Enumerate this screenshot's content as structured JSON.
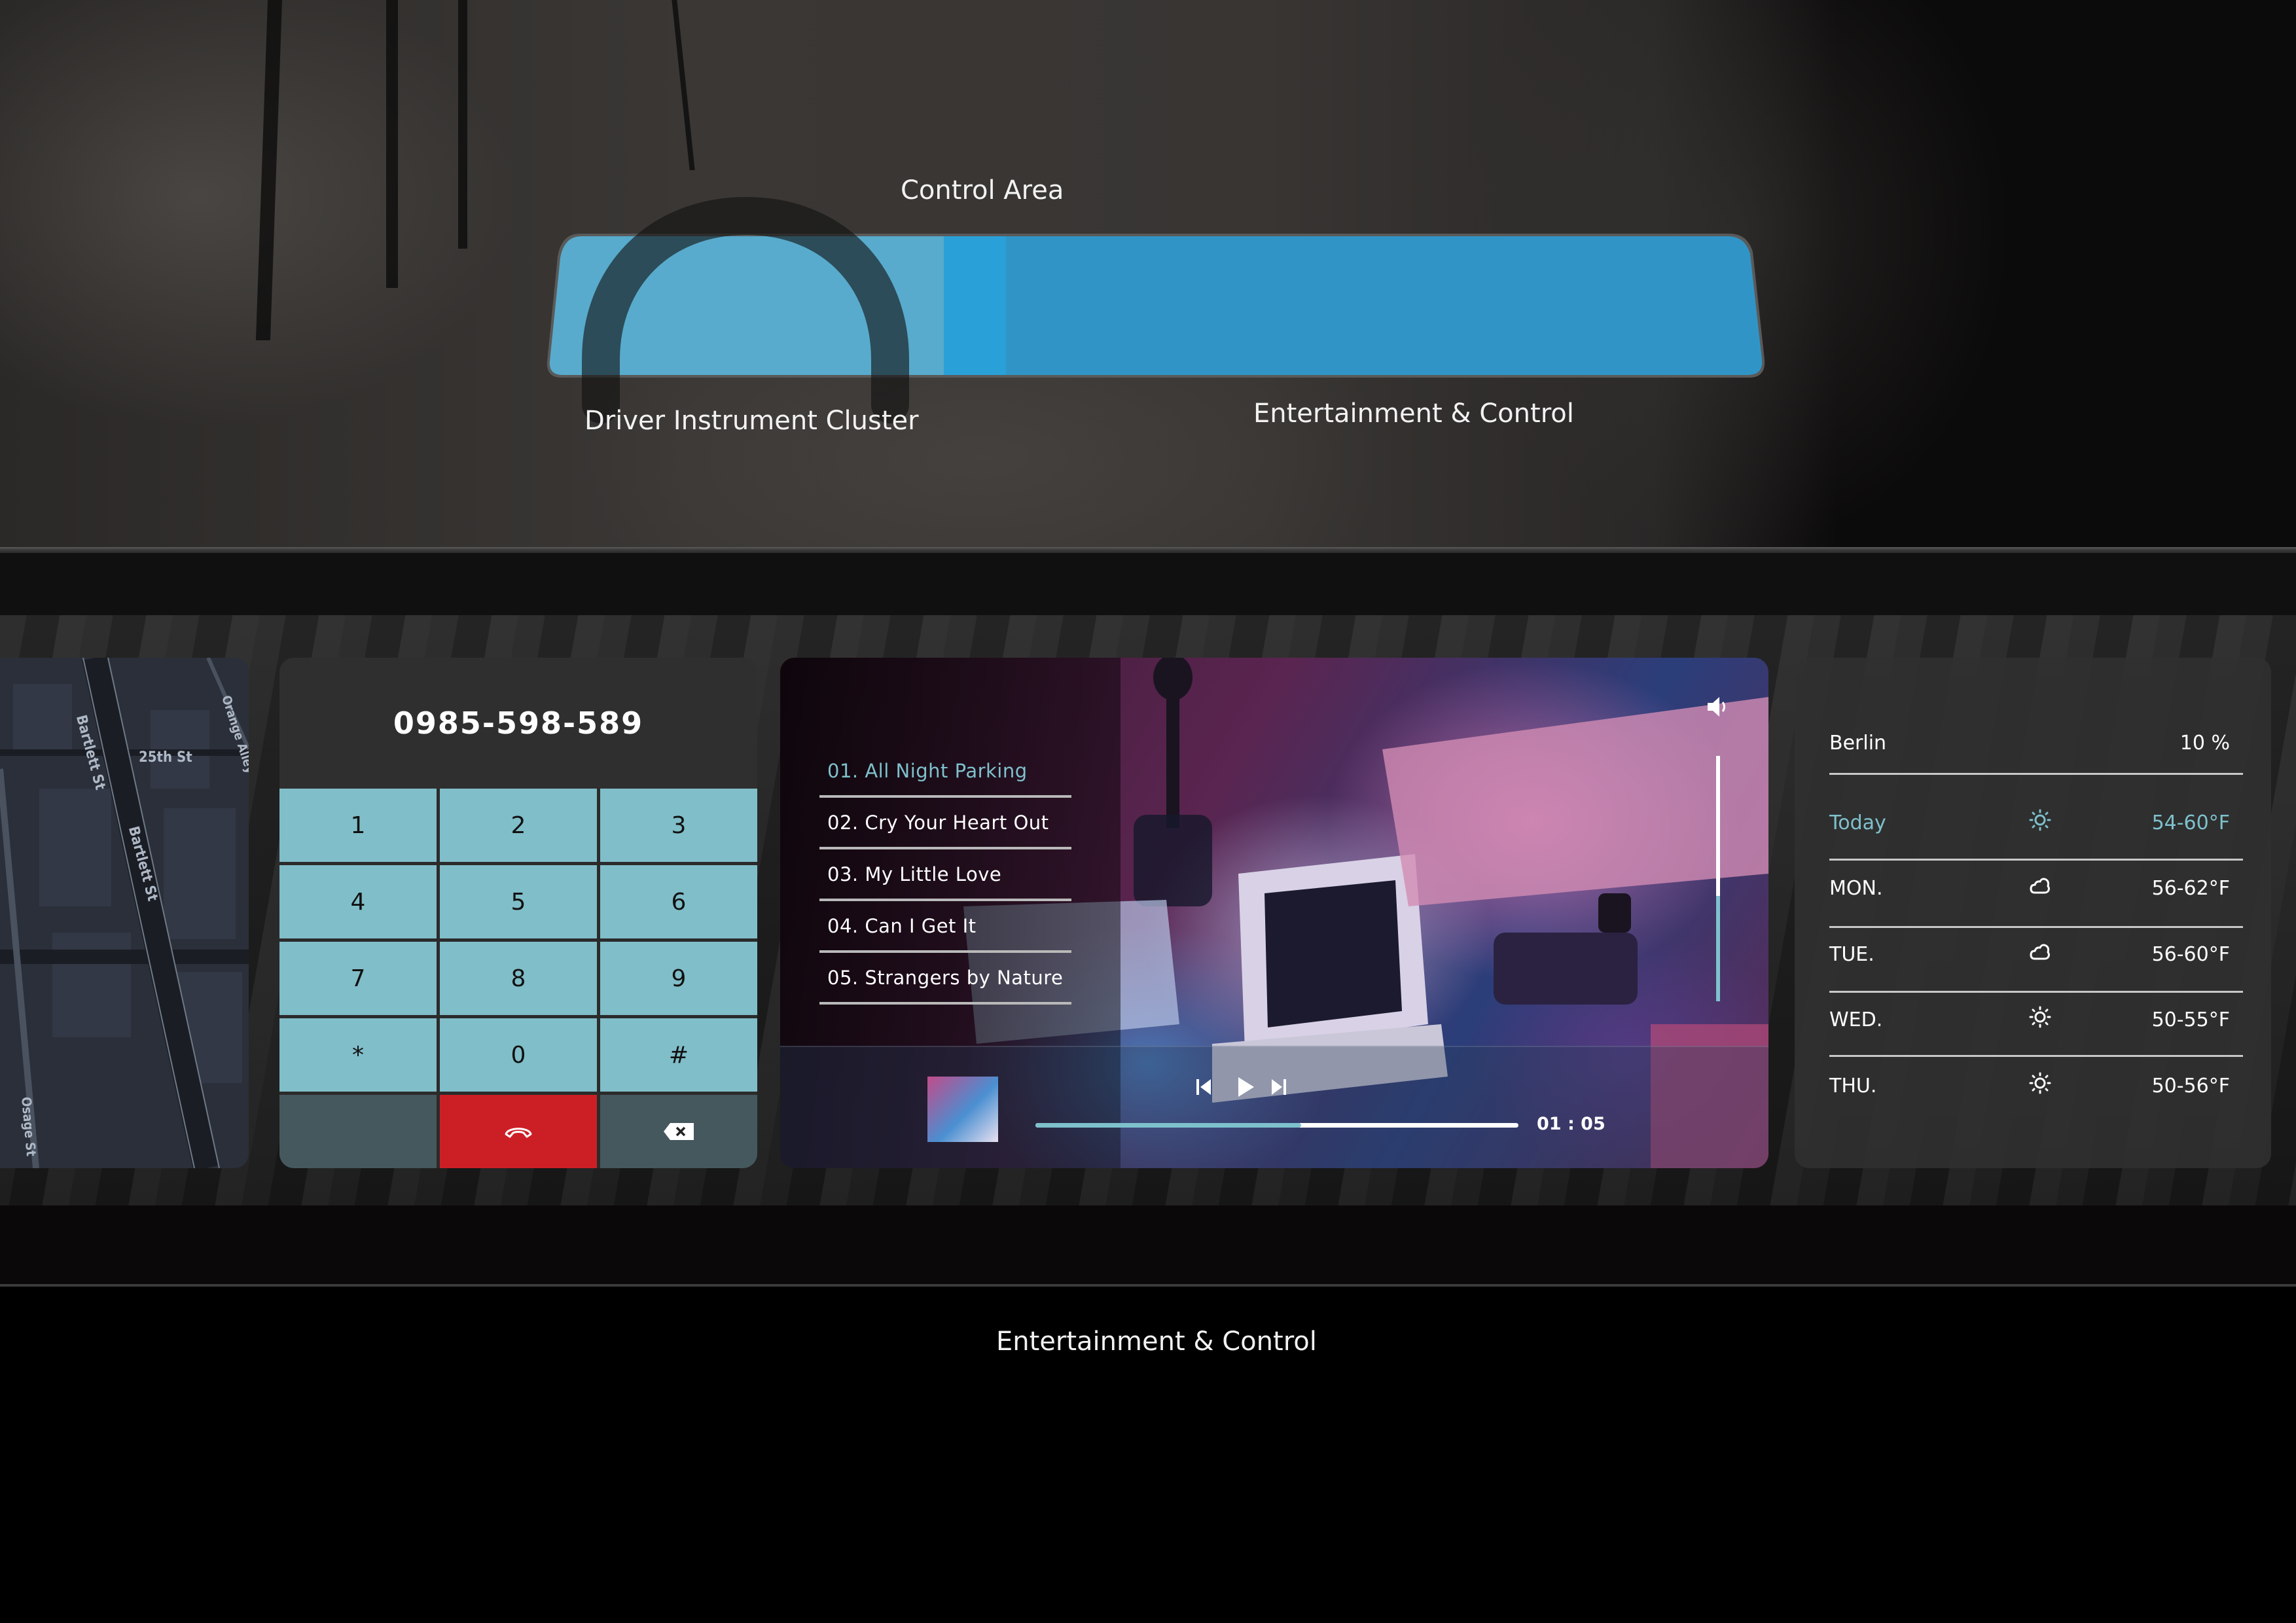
{
  "diagram": {
    "title": "Control Area",
    "left_label": "Driver Instrument Cluster",
    "right_label": "Entertainment & Control",
    "colors": {
      "cluster_zone": "#58abcc",
      "divider_strip": "#2aa0d8",
      "control_zone": "#3095c6",
      "arc": "#1a1a1a",
      "outline": "#5a5a5a"
    }
  },
  "section_label": "Entertainment & Control",
  "map": {
    "streets": [
      "Bartlett St",
      "25th St",
      "Bartlett St",
      "Orange Alley",
      "Osage St"
    ]
  },
  "phone": {
    "number": "0985-598-589",
    "keys": [
      "1",
      "2",
      "3",
      "4",
      "5",
      "6",
      "7",
      "8",
      "9",
      "*",
      "0",
      "#"
    ],
    "end_call_icon": "phone-hangup-icon",
    "delete_icon": "backspace-icon",
    "colors": {
      "key": "#80bec9",
      "end_call": "#cc1f25"
    }
  },
  "music": {
    "tracks": [
      {
        "label": "01. All Night Parking",
        "active": true
      },
      {
        "label": "02. Cry Your Heart Out",
        "active": false
      },
      {
        "label": "03. My Little Love",
        "active": false
      },
      {
        "label": "04. Can I Get It",
        "active": false
      },
      {
        "label": "05. Strangers by Nature",
        "active": false
      }
    ],
    "elapsed": "01 : 05",
    "progress_fraction": 0.55,
    "volume_fraction": 0.43,
    "icons": {
      "volume": "speaker-icon",
      "previous": "skip-previous-icon",
      "play": "play-icon",
      "next": "skip-next-icon"
    },
    "accent": "#7ec1cc"
  },
  "weather": {
    "city": "Berlin",
    "precipitation": "10 %",
    "days": [
      {
        "day": "Today",
        "icon": "sun-icon",
        "temp": "54-60°F",
        "active": true
      },
      {
        "day": "MON.",
        "icon": "partly-cloudy-icon",
        "temp": "56-62°F",
        "active": false
      },
      {
        "day": "TUE.",
        "icon": "partly-cloudy-icon",
        "temp": "56-60°F",
        "active": false
      },
      {
        "day": "WED.",
        "icon": "sun-icon",
        "temp": "50-55°F",
        "active": false
      },
      {
        "day": "THU.",
        "icon": "sun-icon",
        "temp": "50-56°F",
        "active": false
      }
    ],
    "accent": "#7ec1cc"
  }
}
